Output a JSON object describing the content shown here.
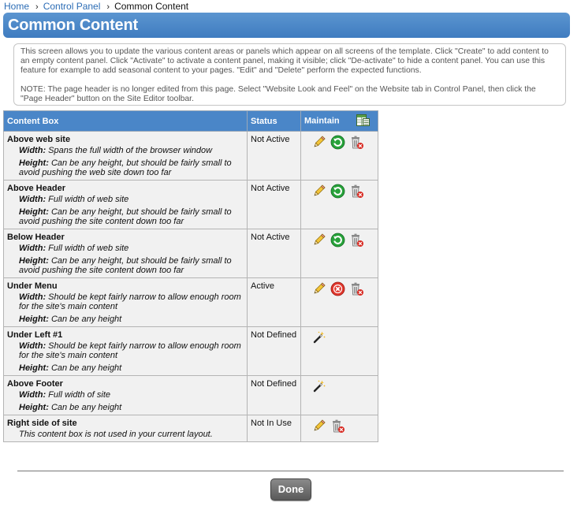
{
  "breadcrumb": {
    "items": [
      "Home",
      "Control Panel"
    ],
    "current": "Common Content"
  },
  "page": {
    "title": "Common Content",
    "intro": "This screen allows you to update the various content areas or panels which appear on all screens of the template. Click \"Create\" to add content to an empty content panel. Click \"Activate\" to activate a content panel, making it visible; click \"De-activate\" to hide a content panel. You can use this feature for example to add seasonal content to your pages. \"Edit\" and \"Delete\" perform the expected functions.",
    "note": "NOTE: The page header is no longer edited from this page. Select \"Website Look and Feel\" on the Website tab in Control Panel, then click the \"Page Header\" button on the Site Editor toolbar."
  },
  "table": {
    "headers": {
      "content_box": "Content Box",
      "status": "Status",
      "maintain": "Maintain"
    },
    "rows": [
      {
        "name": "Above web site",
        "details": [
          {
            "label": "Width:",
            "text": " Spans the full width of the browser window"
          },
          {
            "label": "Height:",
            "text": " Can be any height, but should be fairly small to avoid pushing the web site down too far"
          }
        ],
        "status": "Not Active",
        "actions": [
          "edit",
          "activate",
          "delete"
        ]
      },
      {
        "name": "Above Header",
        "details": [
          {
            "label": "Width:",
            "text": " Full width of web site"
          },
          {
            "label": "Height:",
            "text": " Can be any height, but should be fairly small to avoid pushing the site content down too far"
          }
        ],
        "status": "Not Active",
        "actions": [
          "edit",
          "activate",
          "delete"
        ]
      },
      {
        "name": "Below Header",
        "details": [
          {
            "label": "Width:",
            "text": " Full width of web site"
          },
          {
            "label": "Height:",
            "text": " Can be any height, but should be fairly small to avoid pushing the site content down too far"
          }
        ],
        "status": "Not Active",
        "actions": [
          "edit",
          "activate",
          "delete"
        ]
      },
      {
        "name": "Under Menu",
        "details": [
          {
            "label": "Width:",
            "text": " Should be kept fairly narrow to allow enough room for the site's main content"
          },
          {
            "label": "Height:",
            "text": " Can be any height"
          }
        ],
        "status": "Active",
        "actions": [
          "edit",
          "deactivate",
          "delete"
        ]
      },
      {
        "name": "Under Left #1",
        "details": [
          {
            "label": "Width:",
            "text": " Should be kept fairly narrow to allow enough room for the site's main content"
          },
          {
            "label": "Height:",
            "text": " Can be any height"
          }
        ],
        "status": "Not Defined",
        "actions": [
          "create"
        ]
      },
      {
        "name": "Above Footer",
        "details": [
          {
            "label": "Width:",
            "text": " Full width of site"
          },
          {
            "label": "Height:",
            "text": " Can be any height"
          }
        ],
        "status": "Not Defined",
        "actions": [
          "create"
        ]
      },
      {
        "name": "Right side of site",
        "details": [
          {
            "label": "",
            "text": "This content box is not used in your current layout."
          }
        ],
        "status": "Not In Use",
        "actions": [
          "edit",
          "delete"
        ]
      }
    ]
  },
  "icons": {
    "edit": "pencil-icon",
    "activate": "activate-icon",
    "deactivate": "deactivate-icon",
    "delete": "trash-delete-icon",
    "create": "magic-wand-icon",
    "export": "spreadsheet-icon"
  },
  "colors": {
    "title_bar": "#4a86c8",
    "header": "#4a86c8",
    "link": "#2b6cb5",
    "activate_green": "#27a23a",
    "deactivate_red": "#e0362c",
    "done_button": "#6b6b6b"
  },
  "footer": {
    "done_label": "Done"
  }
}
